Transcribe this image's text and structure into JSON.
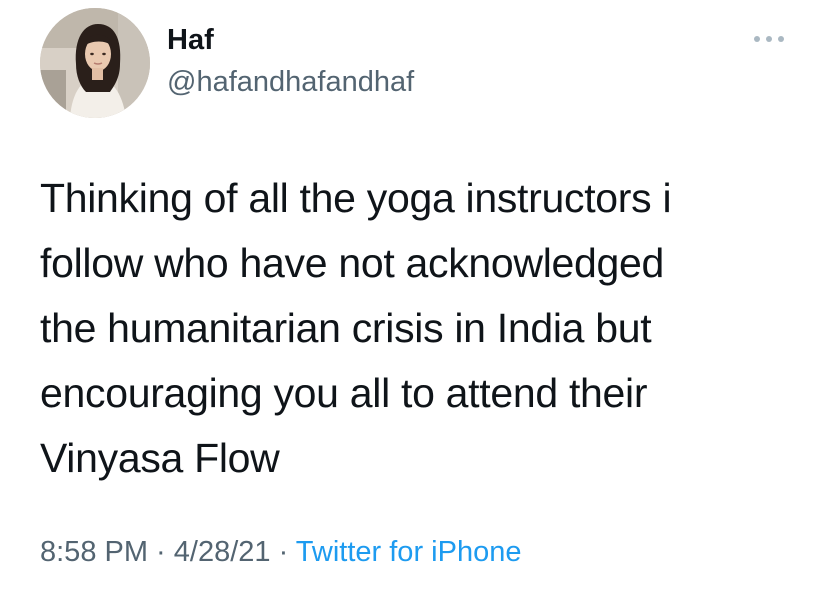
{
  "author": {
    "display_name": "Haf",
    "handle": "@hafandhafandhaf",
    "avatar_icon": "profile-photo"
  },
  "header": {
    "more_icon": "more-horizontal-icon"
  },
  "tweet": {
    "lines": [
      "Thinking of all the yoga instructors i",
      "follow who have not acknowledged",
      "the humanitarian crisis in India but",
      "encouraging you all to attend their",
      "Vinyasa Flow"
    ]
  },
  "meta": {
    "time": "8:58 PM",
    "separator_1": " · ",
    "date": "4/28/21",
    "separator_2": " · ",
    "source": "Twitter for iPhone"
  },
  "colors": {
    "text_primary": "#0f1419",
    "text_secondary": "#536471",
    "accent": "#1d9bf0",
    "background": "#ffffff"
  }
}
